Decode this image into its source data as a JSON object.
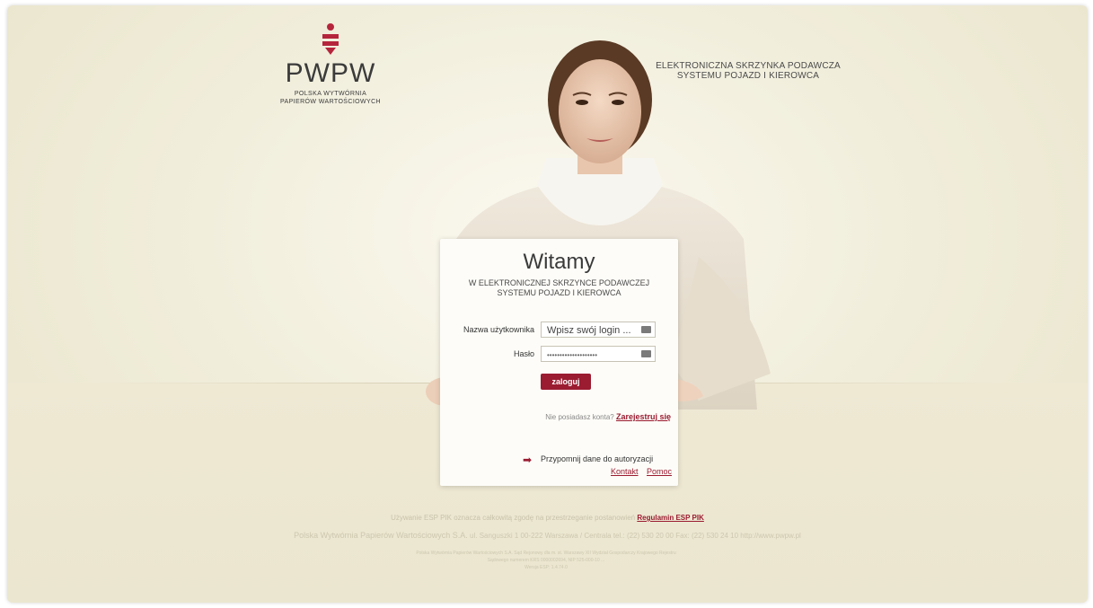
{
  "logo": {
    "word": "PWPW",
    "subtitle_line1": "POLSKA WYTWÓRNIA",
    "subtitle_line2": "PAPIERÓW WARTOŚCIOWYCH"
  },
  "header": {
    "line1": "ELEKTRONICZNA SKRZYNKA PODAWCZA",
    "line2": "SYSTEMU POJAZD I KIEROWCA"
  },
  "card": {
    "title": "Witamy",
    "subtitle_line1": "W ELEKTRONICZNEJ SKRZYNCE PODAWCZEJ",
    "subtitle_line2": "SYSTEMU POJAZD I KIEROWCA",
    "username_label": "Nazwa użytkownika",
    "username_value": "Wpisz swój login ...",
    "password_label": "Hasło",
    "password_value": "••••••••••••••••••••",
    "login_button": "zaloguj",
    "no_account_text": "Nie posiadasz konta?",
    "register_link": "Zarejestruj się",
    "remind_link": "Przypomnij dane do autoryzacji",
    "contact_link": "Kontakt",
    "help_link": "Pomoc"
  },
  "footer": {
    "terms_text": "Używanie ESP PIK oznacza całkowitą zgodę na przestrzeganie postanowień",
    "terms_link": "Regulamin ESP PIK",
    "company_name": "Polska Wytwórnia Papierów Wartościowych S.A.",
    "company_address": "ul. Sanguszki 1 00-222 Warszawa / Centrala tel.: (22) 530 20 00 Fax: (22) 530 24 10 http://www.pwpw.pl",
    "legal_line1": "Polska Wytwórnia Papierów Wartościowych S.A. Sąd Rejonowy dla m. st. Warszawy XII Wydział Gospodarczy Krajowego Rejestru",
    "legal_line2": "Sądowego numerem KRS 0000002694, NIP 525-000-10 ...",
    "legal_line3": "Wersja ESP: 1.4.74.0"
  },
  "colors": {
    "accent": "#9b1b30",
    "background": "#f1eedc",
    "card": "#fdfcf8"
  }
}
